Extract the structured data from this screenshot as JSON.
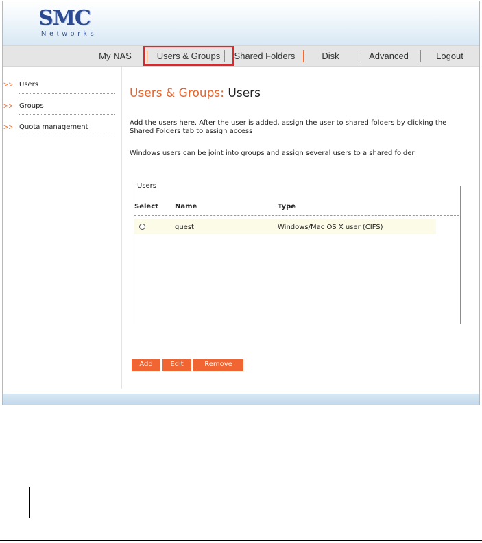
{
  "logo": {
    "main": "SMC",
    "sub": "Networks"
  },
  "nav": {
    "items": [
      "My NAS",
      "Users & Groups",
      "Shared Folders",
      "Disk",
      "Advanced",
      "Logout"
    ],
    "active": "Users & Groups"
  },
  "sidebar": {
    "arrow": ">>",
    "items": [
      "Users",
      "Groups",
      "Quota management"
    ]
  },
  "page": {
    "title_prefix": "Users & Groups:",
    "title_suffix": "Users",
    "para1": "Add the users here. After the user is added, assign the user to shared folders by clicking the Shared Folders tab to assign access",
    "para2": "Windows users can be joint into groups and assign several users to a shared folder"
  },
  "users_table": {
    "legend": "Users",
    "columns": [
      "Select",
      "Name",
      "Type"
    ],
    "rows": [
      {
        "name": "guest",
        "type": "Windows/Mac OS X user (CIFS)"
      }
    ]
  },
  "buttons": {
    "add": "Add",
    "edit": "Edit",
    "remove": "Remove"
  },
  "colors": {
    "accent": "#f06531",
    "highlight_box": "#e0262b",
    "brand": "#2c4a8f"
  },
  "icons": [
    "radio-button-icon"
  ]
}
